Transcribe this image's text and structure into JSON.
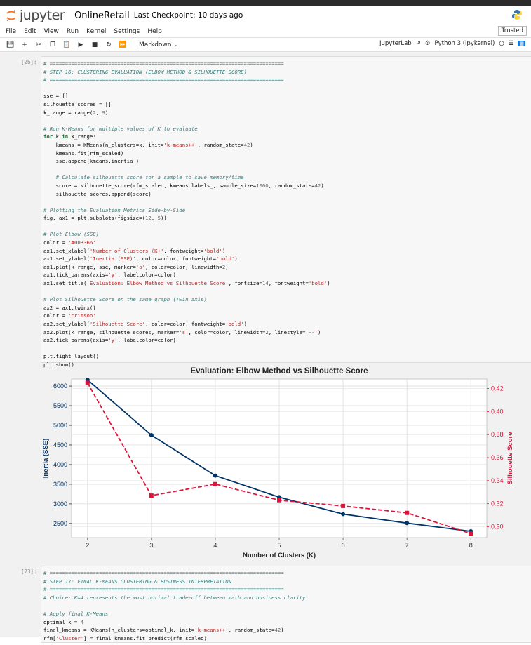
{
  "header": {
    "logo_text": "jupyter",
    "notebook_name": "OnlineRetail",
    "checkpoint": "Last Checkpoint: 10 days ago"
  },
  "menu": {
    "items": [
      "File",
      "Edit",
      "View",
      "Run",
      "Kernel",
      "Settings",
      "Help"
    ],
    "trusted": "Trusted"
  },
  "toolbar": {
    "cell_type": "Markdown",
    "jupyterlab": "JupyterLab",
    "kernel": "Python 3 (ipykernel)"
  },
  "cells": {
    "cell1_prompt": "[26]:",
    "cell2_prompt": "[23]:",
    "cell1_lines": [
      "# ============================================================================",
      "# STEP 16: CLUSTERING EVALUATION (ELBOW METHOD & SILHOUETTE SCORE)",
      "# ============================================================================",
      "",
      "sse = []",
      "silhouette_scores = []",
      "k_range = range(2, 9)",
      "",
      "# Run K-Means for multiple values of K to evaluate",
      "for k in k_range:",
      "    kmeans = KMeans(n_clusters=k, init='k-means++', random_state=42)",
      "    kmeans.fit(rfm_scaled)",
      "    sse.append(kmeans.inertia_)",
      "",
      "    # Calculate silhouette score for a sample to save memory/time",
      "    score = silhouette_score(rfm_scaled, kmeans.labels_, sample_size=1000, random_state=42)",
      "    silhouette_scores.append(score)",
      "",
      "# Plotting the Evaluation Metrics Side-by-Side",
      "fig, ax1 = plt.subplots(figsize=(12, 5))",
      "",
      "# Plot Elbow (SSE)",
      "color = '#003366'",
      "ax1.set_xlabel('Number of Clusters (K)', fontweight='bold')",
      "ax1.set_ylabel('Inertia (SSE)', color=color, fontweight='bold')",
      "ax1.plot(k_range, sse, marker='o', color=color, linewidth=2)",
      "ax1.tick_params(axis='y', labelcolor=color)",
      "ax1.set_title('Evaluation: Elbow Method vs Silhouette Score', fontsize=14, fontweight='bold')",
      "",
      "# Plot Silhouette Score on the same graph (Twin axis)",
      "ax2 = ax1.twinx()",
      "color = 'crimson'",
      "ax2.set_ylabel('Silhouette Score', color=color, fontweight='bold')",
      "ax2.plot(k_range, silhouette_scores, marker='s', color=color, linewidth=2, linestyle='--')",
      "ax2.tick_params(axis='y', labelcolor=color)",
      "",
      "plt.tight_layout()",
      "plt.show()"
    ],
    "cell2_lines": [
      "# ============================================================================",
      "# STEP 17: FINAL K-MEANS CLUSTERING & BUSINESS INTERPRETATION",
      "# ============================================================================",
      "# Choice: K=4 represents the most optimal trade-off between math and business clarity.",
      "",
      "# Apply final K-Means",
      "optimal_k = 4",
      "final_kmeans = KMeans(n_clusters=optimal_k, init='k-means++', random_state=42)",
      "rfm['Cluster'] = final_kmeans.fit_predict(rfm_scaled)"
    ]
  },
  "chart_data": {
    "type": "line",
    "title": "Evaluation: Elbow Method vs Silhouette Score",
    "xlabel": "Number of Clusters (K)",
    "ylabel": "Inertia (SSE)",
    "y2label": "Silhouette Score",
    "x": [
      2,
      3,
      4,
      5,
      6,
      7,
      8
    ],
    "xlim": [
      1.75,
      8.25
    ],
    "ylim": [
      2140,
      6180
    ],
    "y2lim": [
      0.2905,
      0.4283
    ],
    "yticks": [
      2500,
      3000,
      3500,
      4000,
      4500,
      5000,
      5500,
      6000
    ],
    "y2ticks": [
      0.3,
      0.32,
      0.34,
      0.36,
      0.38,
      0.4,
      0.42
    ],
    "y2tick_labels": [
      "0.30",
      "0.32",
      "0.34",
      "0.36",
      "0.38",
      "0.40",
      "0.42"
    ],
    "grid": true,
    "series": [
      {
        "axis": "left",
        "color": "#003366",
        "marker": "circle",
        "linestyle": "solid",
        "values": [
          6160,
          4750,
          3720,
          3170,
          2740,
          2510,
          2300
        ]
      },
      {
        "axis": "right",
        "color": "#dc143c",
        "marker": "square",
        "linestyle": "dashed",
        "values": [
          0.425,
          0.327,
          0.337,
          0.323,
          0.318,
          0.312,
          0.294
        ]
      }
    ]
  }
}
